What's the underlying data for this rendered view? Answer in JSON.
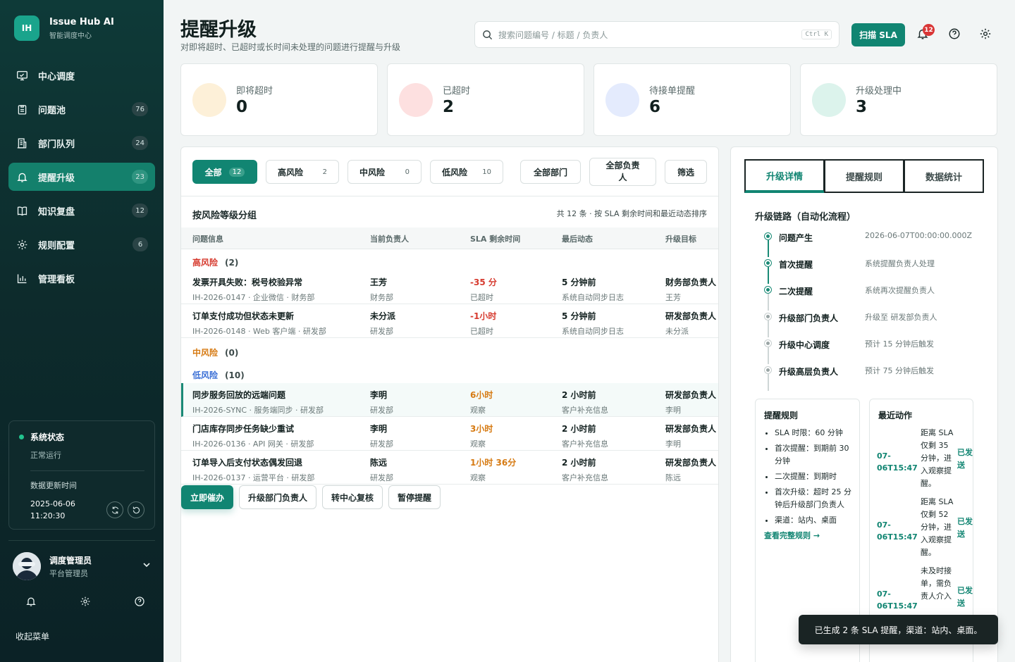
{
  "brand": {
    "logo": "IH",
    "title": "Issue Hub AI",
    "subtitle": "智能调度中心"
  },
  "nav": [
    {
      "label": "中心调度",
      "icon": "monitor-icon",
      "badge": null
    },
    {
      "label": "问题池",
      "icon": "clipboard-icon",
      "badge": "76"
    },
    {
      "label": "部门队列",
      "icon": "building-icon",
      "badge": "24"
    },
    {
      "label": "提醒升级",
      "icon": "bell-icon",
      "badge": "23",
      "active": true
    },
    {
      "label": "知识复盘",
      "icon": "book-icon",
      "badge": "12"
    },
    {
      "label": "规则配置",
      "icon": "gear-icon",
      "badge": "6"
    },
    {
      "label": "管理看板",
      "icon": "bar-chart-icon",
      "badge": null
    }
  ],
  "system": {
    "title": "系统状态",
    "status": "正常运行",
    "update_label": "数据更新时间",
    "date": "2025-06-06",
    "time": "11:20:30"
  },
  "user": {
    "name": "调度管理员",
    "role": "平台管理员"
  },
  "collapse": "收起菜单",
  "header": {
    "title": "提醒升级",
    "subtitle": "对即将超时、已超时或长时间未处理的问题进行提醒与升级",
    "search_placeholder": "搜索问题编号 / 标题 / 负责人",
    "shortcut": "Ctrl K",
    "primary_btn": "扫描 SLA",
    "notif_count": "12"
  },
  "stats": [
    {
      "label": "即将超时",
      "value": "0",
      "color": "#fdf0d8"
    },
    {
      "label": "已超时",
      "value": "2",
      "color": "#fde0e0"
    },
    {
      "label": "待接单提醒",
      "value": "6",
      "color": "#e4ebfd"
    },
    {
      "label": "升级处理中",
      "value": "3",
      "color": "#dcf3ec"
    }
  ],
  "filters": {
    "risk": [
      {
        "label": "全部",
        "count": "12",
        "active": true
      },
      {
        "label": "高风险",
        "count": "2"
      },
      {
        "label": "中风险",
        "count": "0"
      },
      {
        "label": "低风险",
        "count": "10"
      }
    ],
    "dept": "全部部门",
    "owner_line1": "全部负责",
    "owner_line2": "人",
    "more": "筛选"
  },
  "list": {
    "title": "按风险等级分组",
    "note": "共 12 条 · 按 SLA 剩余时间和最近动态排序",
    "columns": [
      "问题信息",
      "当前负责人",
      "SLA 剩余时间",
      "最后动态",
      "升级目标"
    ],
    "groups": [
      {
        "name": "高风险",
        "count": "(2)",
        "color": "#d63a2e"
      },
      {
        "name": "中风险",
        "count": "(0)",
        "color": "#d67a12"
      },
      {
        "name": "低风险",
        "count": "(10)",
        "color": "#3a6fd6"
      }
    ],
    "rows": [
      {
        "title": "发票开具失败：税号校验异常",
        "meta": "IH-2026-0147 · 企业微信 · 财务部",
        "owner": "王芳",
        "owner_dept": "财务部",
        "sla": "-35 分",
        "sla_state": "已超时",
        "last": "5 分钟前",
        "last_desc": "系统自动同步日志",
        "target": "财务部负责人",
        "target_name": "王芳",
        "level": "red"
      },
      {
        "title": "订单支付成功但状态未更新",
        "meta": "IH-2026-0148 · Web 客户端 · 研发部",
        "owner": "未分派",
        "owner_dept": "研发部",
        "sla": "-1小时",
        "sla_state": "已超时",
        "last": "5 分钟前",
        "last_desc": "系统自动同步日志",
        "target": "研发部负责人",
        "target_name": "未分派",
        "level": "red"
      },
      {
        "title": "同步服务回放的远端问题",
        "meta": "IH-2026-SYNC · 服务端同步 · 研发部",
        "owner": "李明",
        "owner_dept": "研发部",
        "sla": "6小时",
        "sla_state": "观察",
        "last": "2 小时前",
        "last_desc": "客户补充信息",
        "target": "研发部负责人",
        "target_name": "李明",
        "level": "orange",
        "selected": true
      },
      {
        "title": "门店库存同步任务缺少重试",
        "meta": "IH-2026-0136 · API 网关 · 研发部",
        "owner": "李明",
        "owner_dept": "研发部",
        "sla": "3小时",
        "sla_state": "观察",
        "last": "2 小时前",
        "last_desc": "客户补充信息",
        "target": "研发部负责人",
        "target_name": "李明",
        "level": "orange"
      },
      {
        "title": "订单导入后支付状态偶发回退",
        "meta": "IH-2026-0137 · 运营平台 · 研发部",
        "owner": "陈远",
        "owner_dept": "研发部",
        "sla": "1小时 36分",
        "sla_state": "观察",
        "last": "2 小时前",
        "last_desc": "客户补充信息",
        "target": "研发部负责人",
        "target_name": "陈远",
        "level": "orange"
      }
    ]
  },
  "actions": [
    "立即催办",
    "升级部门负责人",
    "转中心复核",
    "暂停提醒"
  ],
  "detail": {
    "tabs": [
      "升级详情",
      "提醒规则",
      "数据统计"
    ],
    "chain_title": "升级链路（自动化流程）",
    "chain": [
      {
        "name": "问题产生",
        "desc": "2026-06-07T00:00:00.000Z",
        "done": true
      },
      {
        "name": "首次提醒",
        "desc": "系统提醒负责人处理",
        "done": true
      },
      {
        "name": "二次提醒",
        "desc": "系统再次提醒负责人",
        "done": true
      },
      {
        "name": "升级部门负责人",
        "desc": "升级至 研发部负责人",
        "done": false
      },
      {
        "name": "升级中心调度",
        "desc": "预计 15 分钟后触发",
        "done": false
      },
      {
        "name": "升级高层负责人",
        "desc": "预计 75 分钟后触发",
        "done": false
      }
    ],
    "rules_title": "提醒规则",
    "rules": [
      "SLA 时限：60 分钟",
      "首次提醒：到期前 30 分钟",
      "二次提醒：到期时",
      "首次升级：超时 25 分钟后升级部门负责人",
      "渠道：站内、桌面"
    ],
    "rules_link": "查看完整规则 →",
    "recent_title": "最近动作",
    "recent": [
      {
        "time": "07-06T15:47",
        "text": "距离 SLA 仅剩 35 分钟，进入观察提醒。",
        "status": "已发送"
      },
      {
        "time": "07-06T15:47",
        "text": "距离 SLA 仅剩 52 分钟，进入观察提醒。",
        "status": "已发送"
      },
      {
        "time": "07-06T15:47",
        "text": "未及时接单，需负责人介入",
        "status": "已发送"
      }
    ]
  },
  "toast": "已生成 2 条 SLA 提醒，渠道：站内、桌面。"
}
